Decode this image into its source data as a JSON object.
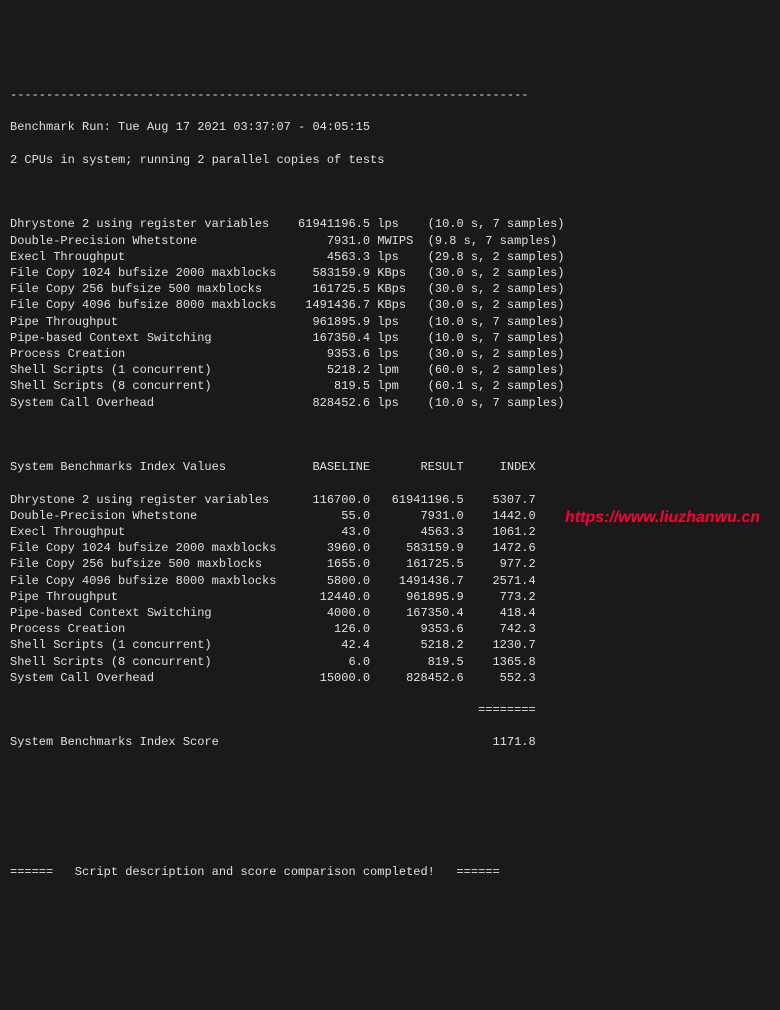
{
  "header": {
    "rule": "------------------------------------------------------------------------",
    "run_line": "Benchmark Run: Tue Aug 17 2021 03:37:07 - 04:05:15",
    "cpu_line": "2 CPUs in system; running 2 parallel copies of tests"
  },
  "tests": [
    {
      "name": "Dhrystone 2 using register variables",
      "value": "61941196.5",
      "unit": "lps",
      "note": "(10.0 s, 7 samples)"
    },
    {
      "name": "Double-Precision Whetstone",
      "value": "7931.0",
      "unit": "MWIPS",
      "note": "(9.8 s, 7 samples)"
    },
    {
      "name": "Execl Throughput",
      "value": "4563.3",
      "unit": "lps",
      "note": "(29.8 s, 2 samples)"
    },
    {
      "name": "File Copy 1024 bufsize 2000 maxblocks",
      "value": "583159.9",
      "unit": "KBps",
      "note": "(30.0 s, 2 samples)"
    },
    {
      "name": "File Copy 256 bufsize 500 maxblocks",
      "value": "161725.5",
      "unit": "KBps",
      "note": "(30.0 s, 2 samples)"
    },
    {
      "name": "File Copy 4096 bufsize 8000 maxblocks",
      "value": "1491436.7",
      "unit": "KBps",
      "note": "(30.0 s, 2 samples)"
    },
    {
      "name": "Pipe Throughput",
      "value": "961895.9",
      "unit": "lps",
      "note": "(10.0 s, 7 samples)"
    },
    {
      "name": "Pipe-based Context Switching",
      "value": "167350.4",
      "unit": "lps",
      "note": "(10.0 s, 7 samples)"
    },
    {
      "name": "Process Creation",
      "value": "9353.6",
      "unit": "lps",
      "note": "(30.0 s, 2 samples)"
    },
    {
      "name": "Shell Scripts (1 concurrent)",
      "value": "5218.2",
      "unit": "lpm",
      "note": "(60.0 s, 2 samples)"
    },
    {
      "name": "Shell Scripts (8 concurrent)",
      "value": "819.5",
      "unit": "lpm",
      "note": "(60.1 s, 2 samples)"
    },
    {
      "name": "System Call Overhead",
      "value": "828452.6",
      "unit": "lps",
      "note": "(10.0 s, 7 samples)"
    }
  ],
  "index_header": {
    "label": "System Benchmarks Index Values",
    "col1": "BASELINE",
    "col2": "RESULT",
    "col3": "INDEX"
  },
  "index_rows": [
    {
      "name": "Dhrystone 2 using register variables",
      "baseline": "116700.0",
      "result": "61941196.5",
      "index": "5307.7"
    },
    {
      "name": "Double-Precision Whetstone",
      "baseline": "55.0",
      "result": "7931.0",
      "index": "1442.0"
    },
    {
      "name": "Execl Throughput",
      "baseline": "43.0",
      "result": "4563.3",
      "index": "1061.2"
    },
    {
      "name": "File Copy 1024 bufsize 2000 maxblocks",
      "baseline": "3960.0",
      "result": "583159.9",
      "index": "1472.6"
    },
    {
      "name": "File Copy 256 bufsize 500 maxblocks",
      "baseline": "1655.0",
      "result": "161725.5",
      "index": "977.2"
    },
    {
      "name": "File Copy 4096 bufsize 8000 maxblocks",
      "baseline": "5800.0",
      "result": "1491436.7",
      "index": "2571.4"
    },
    {
      "name": "Pipe Throughput",
      "baseline": "12440.0",
      "result": "961895.9",
      "index": "773.2"
    },
    {
      "name": "Pipe-based Context Switching",
      "baseline": "4000.0",
      "result": "167350.4",
      "index": "418.4"
    },
    {
      "name": "Process Creation",
      "baseline": "126.0",
      "result": "9353.6",
      "index": "742.3"
    },
    {
      "name": "Shell Scripts (1 concurrent)",
      "baseline": "42.4",
      "result": "5218.2",
      "index": "1230.7"
    },
    {
      "name": "Shell Scripts (8 concurrent)",
      "baseline": "6.0",
      "result": "819.5",
      "index": "1365.8"
    },
    {
      "name": "System Call Overhead",
      "baseline": "15000.0",
      "result": "828452.6",
      "index": "552.3"
    }
  ],
  "score": {
    "label": "System Benchmarks Index Score",
    "value": "1171.8",
    "sep": "========"
  },
  "footer": {
    "line": "======   Script description and score comparison completed!   ======"
  },
  "watermark": "https://www.liuzhanwu.cn"
}
